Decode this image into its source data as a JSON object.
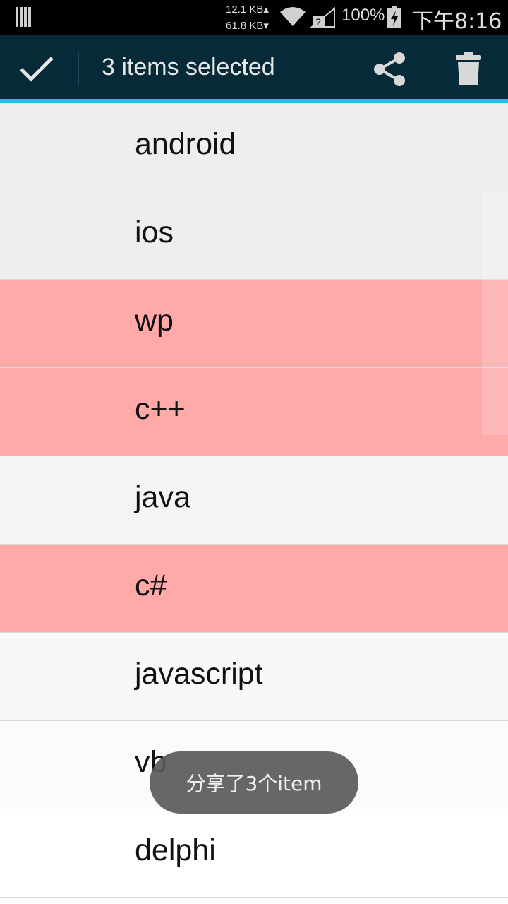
{
  "status_bar": {
    "net_up": "12.1 KB▴",
    "net_down": "61.8 KB▾",
    "battery": "100%",
    "time": "下午8:16",
    "icons": [
      "signal-bars-icon",
      "wifi-icon",
      "no-sim-signal-icon",
      "battery-charging-icon"
    ]
  },
  "action_bar": {
    "title": "3 items selected",
    "done_icon": "check-icon",
    "share_icon": "share-icon",
    "delete_icon": "trash-icon",
    "accent_color": "#33b5e5",
    "background_color": "#062a38"
  },
  "list": {
    "items": [
      {
        "label": "android",
        "selected": false
      },
      {
        "label": "ios",
        "selected": false
      },
      {
        "label": "wp",
        "selected": true
      },
      {
        "label": "c++",
        "selected": true
      },
      {
        "label": "java",
        "selected": false
      },
      {
        "label": "c#",
        "selected": true
      },
      {
        "label": "javascript",
        "selected": false
      },
      {
        "label": "vb",
        "selected": false
      },
      {
        "label": "delphi",
        "selected": false
      }
    ],
    "selected_color": "#ffa9a9"
  },
  "toast": {
    "message": "分享了3个item"
  }
}
